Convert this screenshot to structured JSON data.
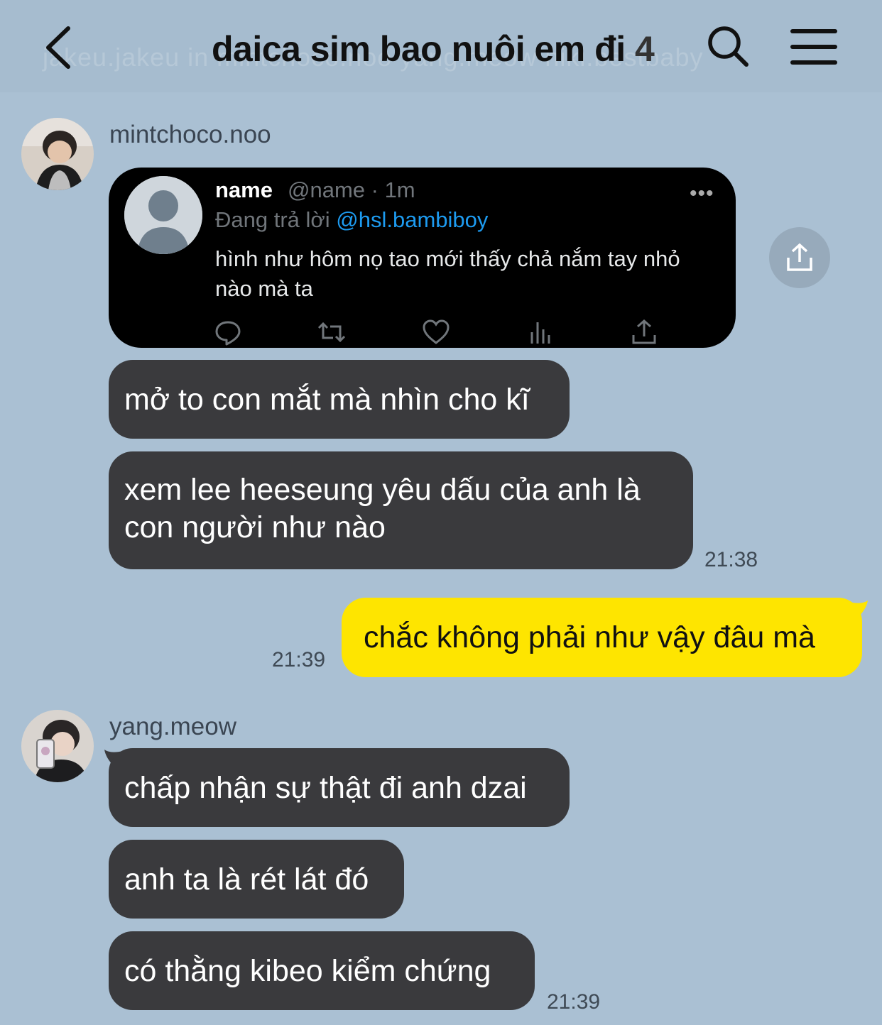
{
  "header": {
    "title": "daica sim bao nuôi em đi",
    "member_count": "4",
    "ghost_text": "jakeu.jakeu in mintchoco.noo yang.meow niki.bestbaby"
  },
  "messages": {
    "group1": {
      "sender": "mintchoco.noo",
      "tweet": {
        "name": "name",
        "handle": "@name · 1m",
        "reply_prefix": "Đang trả lời",
        "reply_mention": "@hsl.bambiboy",
        "text": "hình như hôm nọ tao mới thấy chả nắm tay nhỏ nào mà ta",
        "dots": "•••"
      },
      "bubble1": "mở to con mắt mà nhìn cho kĩ",
      "bubble2_line1": "xem lee heeseung yêu dấu của anh là",
      "bubble2_line2": "con người như nào",
      "time": "21:38"
    },
    "mine": {
      "text": "chắc không phải như vậy đâu mà",
      "time": "21:39"
    },
    "group2": {
      "sender": "yang.meow",
      "bubble1": "chấp nhận sự thật đi anh dzai",
      "bubble2": "anh ta là rét lát đó",
      "bubble3": "có thằng kibeo kiểm chứng",
      "time": "21:39"
    }
  },
  "colors": {
    "background": "#aac0d3",
    "header": "#a6bccf",
    "bubble_other": "#3a3a3d",
    "bubble_mine": "#fee500",
    "tweet_bg": "#000000",
    "mention": "#1d9bf0"
  },
  "icons": [
    "back-icon",
    "search-icon",
    "menu-icon",
    "share-icon",
    "reply-icon",
    "retweet-icon",
    "like-icon",
    "views-icon",
    "tweet-share-icon"
  ]
}
